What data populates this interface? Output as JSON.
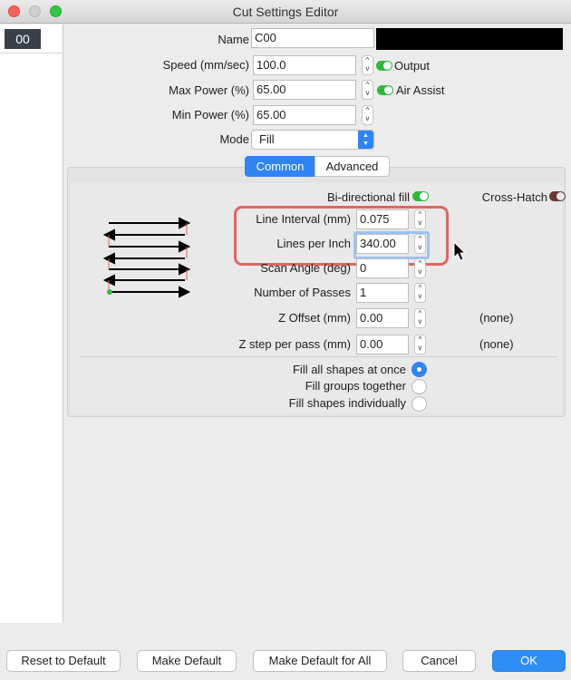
{
  "window": {
    "title": "Cut Settings Editor"
  },
  "sidebar": {
    "items": [
      {
        "label": "00"
      }
    ]
  },
  "general": {
    "name_label": "Name",
    "name_value": "C00",
    "speed_label": "Speed (mm/sec)",
    "speed_value": "100.0",
    "output_label": "Output",
    "max_power_label": "Max Power (%)",
    "max_power_value": "65.00",
    "air_assist_label": "Air Assist",
    "min_power_label": "Min Power (%)",
    "min_power_value": "65.00",
    "mode_label": "Mode",
    "mode_value": "Fill",
    "layer_color": "#000000"
  },
  "tabs": [
    {
      "label": "Common",
      "active": true
    },
    {
      "label": "Advanced",
      "active": false
    }
  ],
  "fill": {
    "bidirectional_label": "Bi-directional fill",
    "crosshatch_label": "Cross-Hatch",
    "line_interval_label": "Line Interval (mm)",
    "line_interval_value": "0.075",
    "lpi_label": "Lines per Inch",
    "lpi_value": "340.00",
    "scan_angle_label": "Scan Angle (deg)",
    "scan_angle_value": "0",
    "passes_label": "Number of Passes",
    "passes_value": "1",
    "z_offset_label": "Z Offset (mm)",
    "z_offset_value": "0.00",
    "z_offset_note": "(none)",
    "z_step_label": "Z step per pass (mm)",
    "z_step_value": "0.00",
    "z_step_note": "(none)"
  },
  "fill_options": [
    {
      "label": "Fill all shapes at once",
      "selected": true
    },
    {
      "label": "Fill groups together",
      "selected": false
    },
    {
      "label": "Fill shapes individually",
      "selected": false
    }
  ],
  "buttons": {
    "reset": "Reset to Default",
    "make_default": "Make Default",
    "make_default_all": "Make Default for All",
    "cancel": "Cancel",
    "ok": "OK"
  },
  "colors": {
    "accent": "#2f84f2",
    "toggle_on": "#31b83c",
    "highlight": "#e2655f"
  }
}
